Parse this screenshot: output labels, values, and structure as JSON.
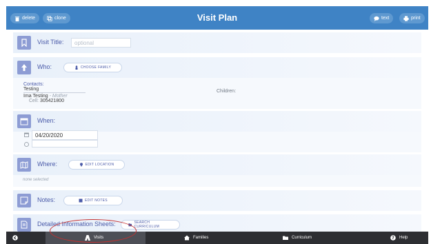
{
  "header": {
    "title": "Visit Plan",
    "delete_label": "delete",
    "clone_label": "clone",
    "text_label": "text",
    "print_label": "print"
  },
  "visit_title": {
    "label": "Visit Title:",
    "placeholder": "optional"
  },
  "who": {
    "label": "Who:",
    "choose_family_label": "CHOOSE FAMILY",
    "contacts_label": "Contacts:",
    "family_name": "Testing",
    "contact_name": "Ima Testing",
    "contact_role": "Mother",
    "cell_label": "Cell:",
    "cell_value": "305421800",
    "children_label": "Children:"
  },
  "when": {
    "label": "When:",
    "date_value": "04/20/2020",
    "time_value": ""
  },
  "where": {
    "label": "Where:",
    "edit_location_label": "EDIT LOCATION",
    "status": "none selected"
  },
  "notes": {
    "label": "Notes:",
    "edit_notes_label": "EDIT NOTES"
  },
  "sheets": {
    "label": "Detailed Information Sheets:",
    "search_label": "SEARCH CURRICULUM"
  },
  "tabs": [
    {
      "label": "Visits",
      "icon": "road-icon"
    },
    {
      "label": "Families",
      "icon": "home-icon"
    },
    {
      "label": "Curriculum",
      "icon": "folder-icon"
    },
    {
      "label": "Help",
      "icon": "question-icon"
    }
  ],
  "colors": {
    "header": "#3f83c5",
    "accent": "#4a5aa8",
    "icon_tile": "#8d9cd4",
    "tabbar": "#2d2e32",
    "annotation": "#c43131"
  }
}
